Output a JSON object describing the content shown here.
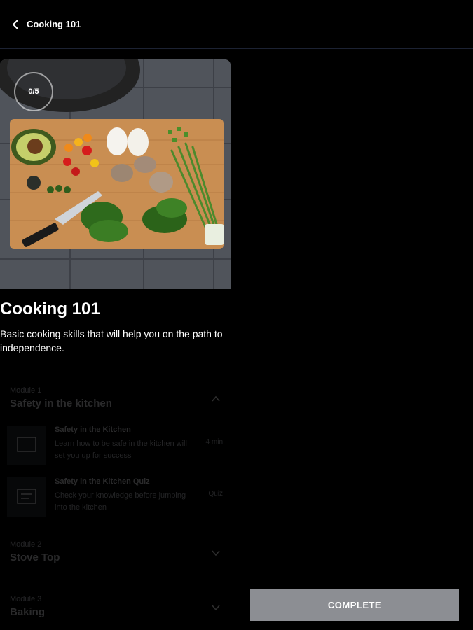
{
  "header": {
    "title": "Cooking 101"
  },
  "hero": {
    "progress": "0/5"
  },
  "course": {
    "title": "Cooking 101",
    "description": "Basic cooking skills that will help you on the path to independence."
  },
  "modules": [
    {
      "label": "Module 1",
      "name": "Safety in the kitchen",
      "expanded": true,
      "lessons": [
        {
          "title": "Safety in the Kitchen",
          "description": "Learn how to be safe in the kitchen will set you up for success",
          "meta": "4 min"
        },
        {
          "title": "Safety in the Kitchen Quiz",
          "description": "Check your knowledge before jumping into the kitchen",
          "meta": "Quiz"
        }
      ]
    },
    {
      "label": "Module 2",
      "name": "Stove Top",
      "expanded": false
    },
    {
      "label": "Module 3",
      "name": "Baking",
      "expanded": false
    }
  ],
  "actions": {
    "complete_label": "COMPLETE"
  }
}
